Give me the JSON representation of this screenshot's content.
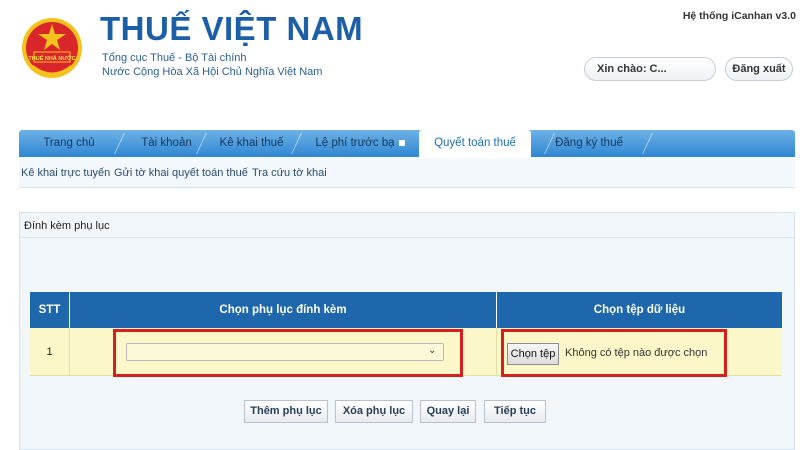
{
  "header": {
    "brand_title": "THUẾ VIỆT NAM",
    "brand_sub1": "Tổng cục Thuế - Bộ Tài chính",
    "brand_sub2": "Nước Cộng Hòa Xã Hội Chủ Nghĩa Việt Nam",
    "emblem_text": "THUẾ NHÀ NƯỚC",
    "system_name": "Hệ thống iCanhan v3.0",
    "greeting": "Xin chào: C...",
    "logout_label": "Đăng xuất"
  },
  "tabs": [
    {
      "label": "Trang chủ"
    },
    {
      "label": "Tài khoản"
    },
    {
      "label": "Kê khai thuế"
    },
    {
      "label": "Lệ phí trước bạ"
    },
    {
      "label": "Quyết toán thuế",
      "active": true
    },
    {
      "label": "Đăng ký thuế"
    }
  ],
  "subnav": {
    "items": [
      "Kê khai trực tuyến",
      "Gửi tờ khai quyết toán thuế",
      "Tra cứu tờ khai"
    ]
  },
  "panel": {
    "title": "Đính kèm phụ lục"
  },
  "table": {
    "headers": [
      "STT",
      "Chọn phụ lục đính kèm",
      "Chọn tệp dữ liệu"
    ],
    "rows": [
      {
        "stt": "1",
        "select_value": "",
        "choose_file_label": "Chọn tệp",
        "file_status": "Không có tệp nào được chọn"
      }
    ]
  },
  "actions": {
    "add": "Thêm phụ lục",
    "remove": "Xóa phụ lục",
    "back": "Quay lại",
    "next": "Tiếp tục"
  },
  "colors": {
    "brand_blue": "#1d5fa7",
    "tab_blue": "#2f86d2",
    "header_blue": "#1e67ad",
    "row_yellow": "#fbf7c8",
    "highlight_red": "#d62020"
  }
}
